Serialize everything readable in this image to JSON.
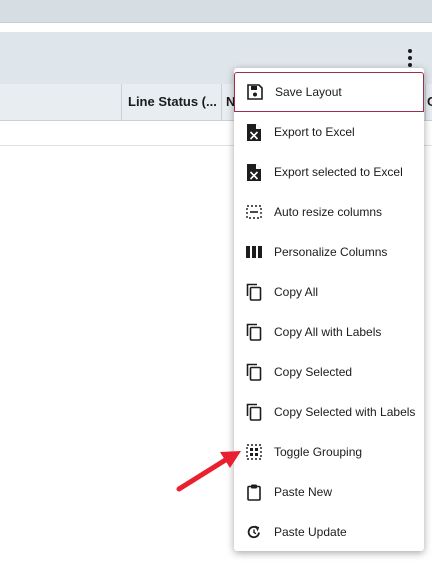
{
  "grid": {
    "columns": [
      {
        "label": "Line Status (..."
      },
      {
        "label": "N"
      },
      {
        "label": "C"
      }
    ]
  },
  "menu": {
    "items": [
      {
        "label": "Save Layout",
        "icon": "save-icon"
      },
      {
        "label": "Export to Excel",
        "icon": "excel-file-icon"
      },
      {
        "label": "Export selected to Excel",
        "icon": "excel-file-icon"
      },
      {
        "label": "Auto resize columns",
        "icon": "resize-columns-icon"
      },
      {
        "label": "Personalize Columns",
        "icon": "columns-icon"
      },
      {
        "label": "Copy All",
        "icon": "copy-icon"
      },
      {
        "label": "Copy All with Labels",
        "icon": "copy-icon"
      },
      {
        "label": "Copy Selected",
        "icon": "copy-icon"
      },
      {
        "label": "Copy Selected with Labels",
        "icon": "copy-icon"
      },
      {
        "label": "Toggle Grouping",
        "icon": "grouping-icon"
      },
      {
        "label": "Paste New",
        "icon": "clipboard-icon"
      },
      {
        "label": "Paste Update",
        "icon": "refresh-icon"
      }
    ]
  },
  "colors": {
    "toolbar_bg": "#dfe6eb",
    "focus_border": "#9e2f4a",
    "annotation_arrow": "#e8202f"
  }
}
